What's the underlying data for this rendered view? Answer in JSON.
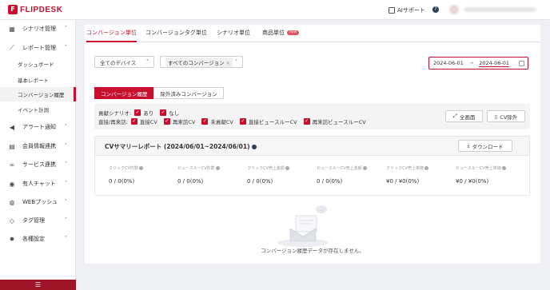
{
  "header": {
    "logo_mark": "F",
    "logo_text": "FLIPDESK",
    "support_label": "AIサポート",
    "help_label": "?"
  },
  "sidebar": {
    "items": [
      {
        "label": "シナリオ管理",
        "icon": "scenario-icon",
        "chevron": "˅"
      },
      {
        "label": "レポート管理",
        "icon": "report-icon",
        "chevron": "˄"
      },
      {
        "label": "アラート通知",
        "icon": "alert-icon",
        "chevron": "˅"
      },
      {
        "label": "会員情報連携",
        "icon": "member-icon",
        "chevron": "˅"
      },
      {
        "label": "サービス連携",
        "icon": "service-link-icon",
        "chevron": "˅"
      },
      {
        "label": "有人チャット",
        "icon": "chat-icon",
        "chevron": "˅"
      },
      {
        "label": "WEBプッシュ",
        "icon": "push-icon",
        "chevron": "˅"
      },
      {
        "label": "タグ管理",
        "icon": "tag-icon",
        "chevron": "˅"
      },
      {
        "label": "各種設定",
        "icon": "settings-icon",
        "chevron": "˅"
      }
    ],
    "report_subitems": [
      "ダッシュボード",
      "基本レポート",
      "コンバージョン履歴",
      "イベント計測"
    ],
    "active_subitem": "コンバージョン履歴",
    "footer_icon": "☰"
  },
  "tabs": [
    {
      "label": "コンバージョン単位",
      "active": true
    },
    {
      "label": "コンバージョンタグ単位",
      "active": false
    },
    {
      "label": "シナリオ単位",
      "active": false
    },
    {
      "label": "商品単位",
      "active": false,
      "badge": "new"
    }
  ],
  "filters": {
    "device_select": "全てのデバイス",
    "conversion_chip": "すべてのコンバージョン",
    "date_start": "2024-06-01",
    "date_end": "2024-06-01",
    "date_arrow": "→"
  },
  "subtabs": [
    {
      "label": "コンバージョン履歴",
      "active": true
    },
    {
      "label": "除外済みコンバージョン",
      "active": false
    }
  ],
  "filter_panel": {
    "contrib_label": "貢献シナリオ:",
    "contrib_options": [
      "あり",
      "なし"
    ],
    "direct_label": "直接/再来訪:",
    "direct_options": [
      "直接CV",
      "再来訪CV",
      "未貢献CV",
      "直接ビュースルーCV",
      "再来訪ビュースルーCV"
    ],
    "fullscreen_label": "全画面",
    "cv_exclude_label": "CV除外"
  },
  "summary": {
    "title": "CVサマリーレポート (2024/06/01~2024/06/01)",
    "download_label": "ダウンロード",
    "metrics": [
      {
        "label": "クリックCV件数",
        "value": "0 / 0(0%)"
      },
      {
        "label": "ビュースルーCV件数",
        "value": "0 / 0(0%)"
      },
      {
        "label": "クリックCV売上金額",
        "value": "0 / 0(0%)"
      },
      {
        "label": "ビュースルーCV売上金額",
        "value": "0 / 0(0%)"
      },
      {
        "label": "クリックCV売上単価",
        "value": "¥0 / ¥0(0%)"
      },
      {
        "label": "ビュースルーCV売上単価",
        "value": "¥0 / ¥0(0%)"
      }
    ]
  },
  "empty_state": {
    "message": "コンバージョン履歴データが存在しません。",
    "bubble": "…"
  },
  "colors": {
    "accent": "#c8102e",
    "sidebar_footer": "#a1152b",
    "panel_bg": "#f4f4f4"
  }
}
